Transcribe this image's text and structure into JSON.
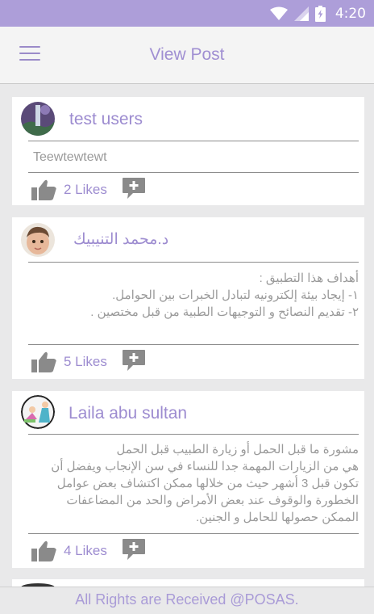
{
  "status_bar": {
    "time": "4:20",
    "icons": [
      "wifi-icon",
      "signal-icon",
      "battery-icon"
    ]
  },
  "app_bar": {
    "title": "View Post",
    "menu_icon": "hamburger-menu-icon"
  },
  "posts": [
    {
      "author": "test users",
      "body": "Teewtewtewt",
      "likes": "2 Likes"
    },
    {
      "author": "د.محمد  التنيبيك",
      "body_lines": [
        "أهداف هذا التطبيق :",
        "١- إيجاد بيئة إلكترونيه لتبادل الخبرات بين الحوامل.",
        "٢- تقديم النصائح و التوجيهات الطبية من قبل مختصين ."
      ],
      "likes": "5 Likes"
    },
    {
      "author": "Laila abu sultan",
      "body_lines": [
        "مشورة ما قبل الحمل  أو زيارة الطبيب قبل الحمل",
        "هي من الزيارات المهمة جدا للنساء في سن الإنجاب ويفضل أن",
        "تكون قبل 3 أشهر حيث من خلالها ممكن اكتشاف بعض عوامل",
        "الخطورة والوقوف عند بعض الأمراض والحد من المضاعفات",
        "الممكن حصولها للحامل و الجنين."
      ],
      "likes": "4 Likes"
    }
  ],
  "footer": {
    "text": "All Rights are Received @POSAS."
  },
  "colors": {
    "accent": "#ad9ed9",
    "accent_text": "#9d8cd0",
    "background": "#e9e9ea"
  }
}
